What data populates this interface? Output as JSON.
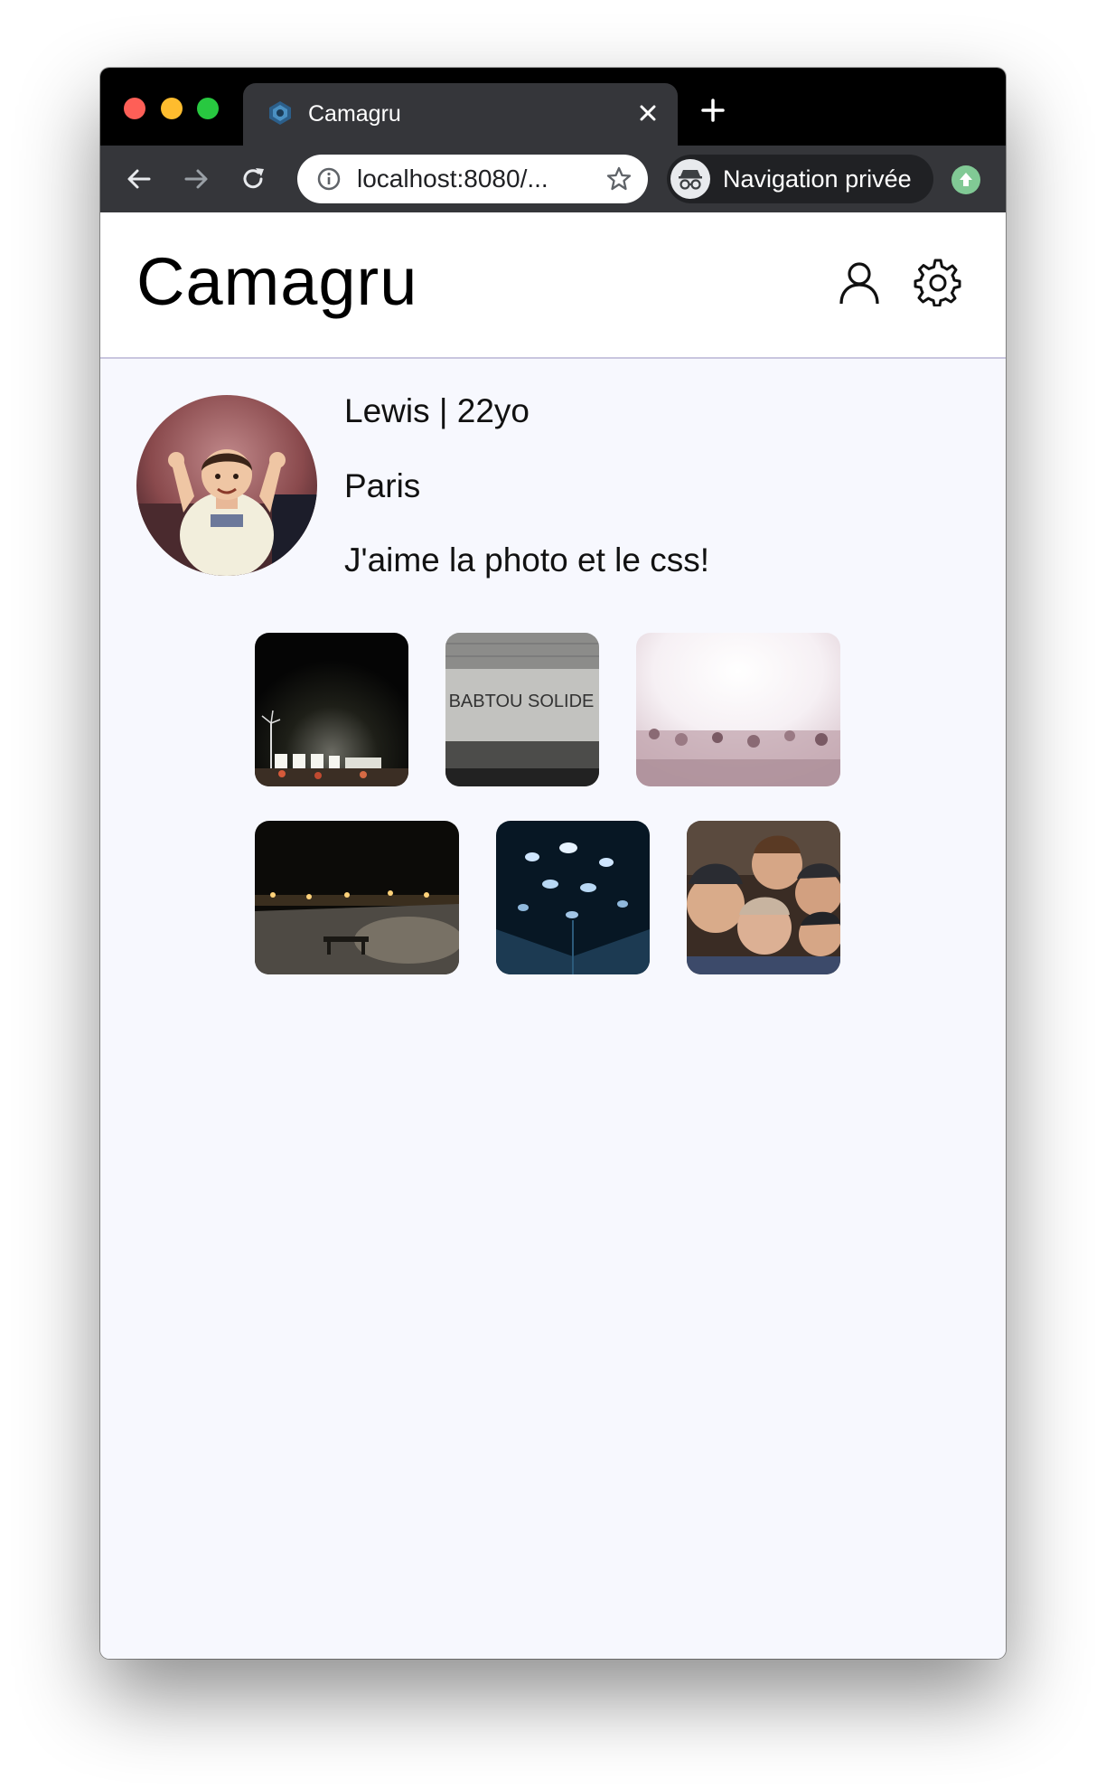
{
  "browser": {
    "tab_title": "Camagru",
    "url": "localhost:8080/...",
    "incognito_label": "Navigation privée"
  },
  "header": {
    "brand": "Camagru",
    "icons": [
      "user-icon",
      "settings-icon"
    ]
  },
  "profile": {
    "name_age": "Lewis | 22yo",
    "city": "Paris",
    "bio": "J'aime la photo et le css!"
  },
  "gallery": {
    "photos": [
      {
        "description_icon": "night-festival-photo"
      },
      {
        "description_icon": "graffiti-wall-photo"
      },
      {
        "description_icon": "concert-crowd-photo"
      },
      {
        "description_icon": "night-promenade-photo"
      },
      {
        "description_icon": "blue-lights-photo"
      },
      {
        "description_icon": "group-selfie-photo"
      }
    ],
    "graffiti_text": "BABTOU SOLIDE"
  },
  "colors": {
    "window_bg": "#f7f8fe",
    "header_border": "#c9c6df",
    "tab_bg": "#35363a"
  }
}
